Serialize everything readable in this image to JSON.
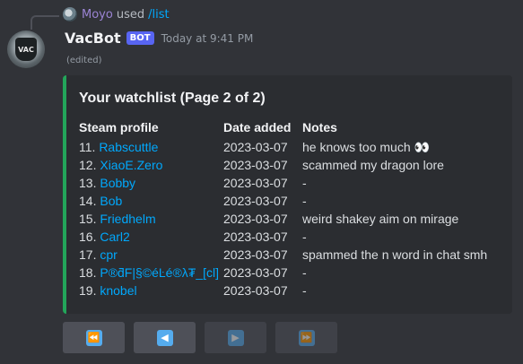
{
  "reply": {
    "user": "Moyo",
    "used": "used",
    "command": "/list"
  },
  "message": {
    "username": "VacBot",
    "bot_tag": "BOT",
    "timestamp": "Today at 9:41 PM",
    "edited": "(edited)",
    "avatar_text": "VAC"
  },
  "embed": {
    "color": "#23a55a",
    "title": "Your watchlist (Page 2 of 2)",
    "headers": {
      "profile": "Steam profile",
      "date": "Date added",
      "notes": "Notes"
    },
    "rows": [
      {
        "num": "11.",
        "name": "Rabscuttle",
        "date": "2023-03-07",
        "note": "he knows too much 👀"
      },
      {
        "num": "12.",
        "name": "XiaoE.Zero",
        "date": "2023-03-07",
        "note": "scammed my dragon lore"
      },
      {
        "num": "13.",
        "name": "Bobby",
        "date": "2023-03-07",
        "note": "-"
      },
      {
        "num": "14.",
        "name": "Bob",
        "date": "2023-03-07",
        "note": "-"
      },
      {
        "num": "15.",
        "name": "Friedhelm",
        "date": "2023-03-07",
        "note": "weird shakey aim on mirage"
      },
      {
        "num": "16.",
        "name": "Carl2",
        "date": "2023-03-07",
        "note": "-"
      },
      {
        "num": "17.",
        "name": "cpr",
        "date": "2023-03-07",
        "note": "spammed the n word in chat smh"
      },
      {
        "num": "18.",
        "name": "P®ƌF|§©éĿé®λ₮_[cl]",
        "date": "2023-03-07",
        "note": "-"
      },
      {
        "num": "19.",
        "name": "knobel",
        "date": "2023-03-07",
        "note": "-"
      }
    ]
  },
  "buttons": [
    {
      "icon": "⏪",
      "name": "first-page-icon",
      "disabled": false
    },
    {
      "icon": "◀",
      "name": "previous-page-icon",
      "disabled": false
    },
    {
      "icon": "▶",
      "name": "next-page-icon",
      "disabled": true
    },
    {
      "icon": "⏩",
      "name": "last-page-icon",
      "disabled": true
    }
  ]
}
